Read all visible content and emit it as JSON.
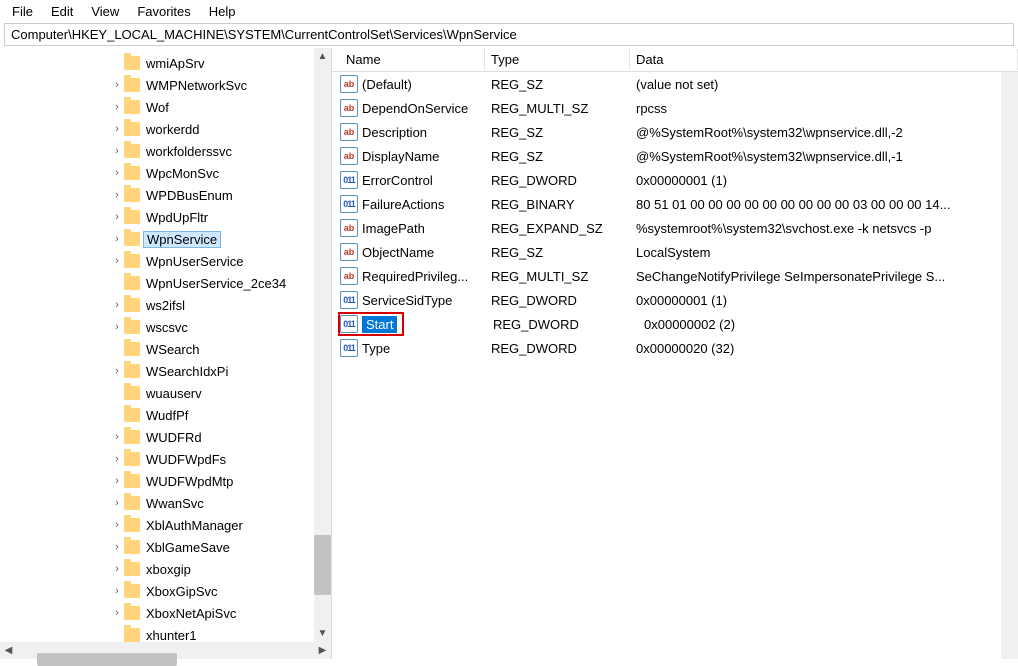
{
  "menu": {
    "file": "File",
    "edit": "Edit",
    "view": "View",
    "favorites": "Favorites",
    "help": "Help"
  },
  "address": "Computer\\HKEY_LOCAL_MACHINE\\SYSTEM\\CurrentControlSet\\Services\\WpnService",
  "tree": [
    {
      "label": "wmiApSrv",
      "expandable": false
    },
    {
      "label": "WMPNetworkSvc",
      "expandable": true
    },
    {
      "label": "Wof",
      "expandable": true
    },
    {
      "label": "workerdd",
      "expandable": true
    },
    {
      "label": "workfolderssvc",
      "expandable": true
    },
    {
      "label": "WpcMonSvc",
      "expandable": true
    },
    {
      "label": "WPDBusEnum",
      "expandable": true
    },
    {
      "label": "WpdUpFltr",
      "expandable": true
    },
    {
      "label": "WpnService",
      "expandable": true,
      "selected": true
    },
    {
      "label": "WpnUserService",
      "expandable": true
    },
    {
      "label": "WpnUserService_2ce34",
      "expandable": false
    },
    {
      "label": "ws2ifsl",
      "expandable": true
    },
    {
      "label": "wscsvc",
      "expandable": true
    },
    {
      "label": "WSearch",
      "expandable": false
    },
    {
      "label": "WSearchIdxPi",
      "expandable": true
    },
    {
      "label": "wuauserv",
      "expandable": false
    },
    {
      "label": "WudfPf",
      "expandable": false
    },
    {
      "label": "WUDFRd",
      "expandable": true
    },
    {
      "label": "WUDFWpdFs",
      "expandable": true
    },
    {
      "label": "WUDFWpdMtp",
      "expandable": true
    },
    {
      "label": "WwanSvc",
      "expandable": true
    },
    {
      "label": "XblAuthManager",
      "expandable": true
    },
    {
      "label": "XblGameSave",
      "expandable": true
    },
    {
      "label": "xboxgip",
      "expandable": true
    },
    {
      "label": "XboxGipSvc",
      "expandable": true
    },
    {
      "label": "XboxNetApiSvc",
      "expandable": true
    },
    {
      "label": "xhunter1",
      "expandable": false
    }
  ],
  "columns": {
    "name": "Name",
    "type": "Type",
    "data": "Data"
  },
  "values": [
    {
      "icon": "sz",
      "name": "(Default)",
      "type": "REG_SZ",
      "data": "(value not set)"
    },
    {
      "icon": "sz",
      "name": "DependOnService",
      "type": "REG_MULTI_SZ",
      "data": "rpcss"
    },
    {
      "icon": "sz",
      "name": "Description",
      "type": "REG_SZ",
      "data": "@%SystemRoot%\\system32\\wpnservice.dll,-2"
    },
    {
      "icon": "sz",
      "name": "DisplayName",
      "type": "REG_SZ",
      "data": "@%SystemRoot%\\system32\\wpnservice.dll,-1"
    },
    {
      "icon": "bin",
      "name": "ErrorControl",
      "type": "REG_DWORD",
      "data": "0x00000001 (1)"
    },
    {
      "icon": "bin",
      "name": "FailureActions",
      "type": "REG_BINARY",
      "data": "80 51 01 00 00 00 00 00 00 00 00 00 03 00 00 00 14..."
    },
    {
      "icon": "sz",
      "name": "ImagePath",
      "type": "REG_EXPAND_SZ",
      "data": "%systemroot%\\system32\\svchost.exe -k netsvcs -p"
    },
    {
      "icon": "sz",
      "name": "ObjectName",
      "type": "REG_SZ",
      "data": "LocalSystem"
    },
    {
      "icon": "sz",
      "name": "RequiredPrivileg...",
      "type": "REG_MULTI_SZ",
      "data": "SeChangeNotifyPrivilege SeImpersonatePrivilege S..."
    },
    {
      "icon": "bin",
      "name": "ServiceSidType",
      "type": "REG_DWORD",
      "data": "0x00000001 (1)"
    },
    {
      "icon": "bin",
      "name": "Start",
      "type": "REG_DWORD",
      "data": "0x00000002 (2)",
      "highlight": true
    },
    {
      "icon": "bin",
      "name": "Type",
      "type": "REG_DWORD",
      "data": "0x00000020 (32)"
    }
  ]
}
